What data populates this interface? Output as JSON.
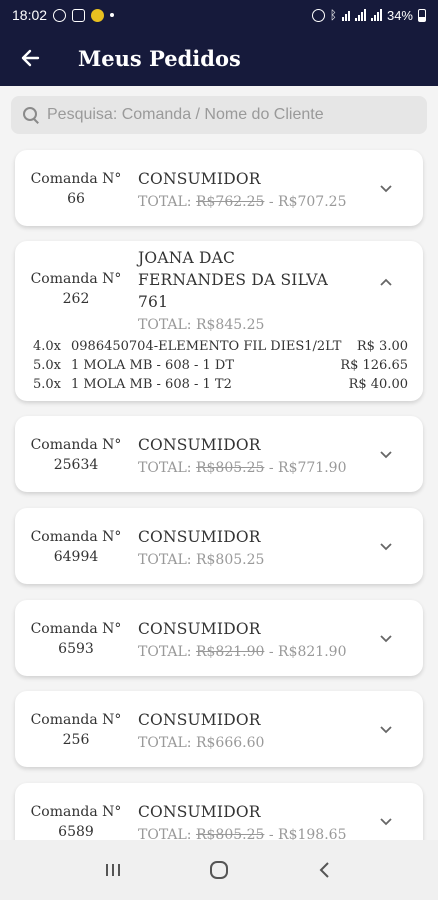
{
  "status": {
    "time": "18:02",
    "battery": "34%"
  },
  "header": {
    "title": "Meus Pedidos"
  },
  "search": {
    "placeholder": "Pesquisa: Comanda / Nome do Cliente"
  },
  "orders": [
    {
      "label": "Comanda N°",
      "number": "66",
      "client": "CONSUMIDOR",
      "total_label": "TOTAL:",
      "original": "R$762.25",
      "sep": " - ",
      "final": "R$707.25",
      "expanded": false
    },
    {
      "label": "Comanda N°",
      "number": "262",
      "client_lines": [
        "JOANA DAC",
        "FERNANDES DA SILVA",
        "761"
      ],
      "total_label": "TOTAL:",
      "final": "R$845.25",
      "expanded": true,
      "items": [
        {
          "qty": "4.0x",
          "desc": "0986450704-ELEMENTO FIL DIES1/2LT",
          "price": "R$ 3.00"
        },
        {
          "qty": "5.0x",
          "desc": "1 MOLA MB - 608 - 1 DT",
          "price": "R$ 126.65"
        },
        {
          "qty": "5.0x",
          "desc": "1 MOLA MB - 608 - 1 T2",
          "price": "R$ 40.00"
        }
      ]
    },
    {
      "label": "Comanda N°",
      "number": "25634",
      "client": "CONSUMIDOR",
      "total_label": "TOTAL:",
      "original": "R$805.25",
      "sep": " - ",
      "final": "R$771.90",
      "expanded": false
    },
    {
      "label": "Comanda N°",
      "number": "64994",
      "client": "CONSUMIDOR",
      "total_label": "TOTAL:",
      "final": "R$805.25",
      "expanded": false
    },
    {
      "label": "Comanda N°",
      "number": "6593",
      "client": "CONSUMIDOR",
      "total_label": "TOTAL:",
      "original": "R$821.90",
      "sep": " - ",
      "final": "R$821.90",
      "expanded": false
    },
    {
      "label": "Comanda N°",
      "number": "256",
      "client": "CONSUMIDOR",
      "total_label": "TOTAL:",
      "final": "R$666.60",
      "expanded": false
    },
    {
      "label": "Comanda N°",
      "number": "6589",
      "client": "CONSUMIDOR",
      "total_label": "TOTAL:",
      "original": "R$805.25",
      "sep": " - ",
      "final": "R$198.65",
      "expanded": false
    }
  ],
  "colors": {
    "appbar": "#161a3b",
    "card": "#ffffff",
    "muted_text": "#999999"
  },
  "icons": {
    "back": "arrow-left-icon",
    "search": "search-icon",
    "expand": "chevron-down-icon",
    "collapse": "chevron-up-icon"
  }
}
